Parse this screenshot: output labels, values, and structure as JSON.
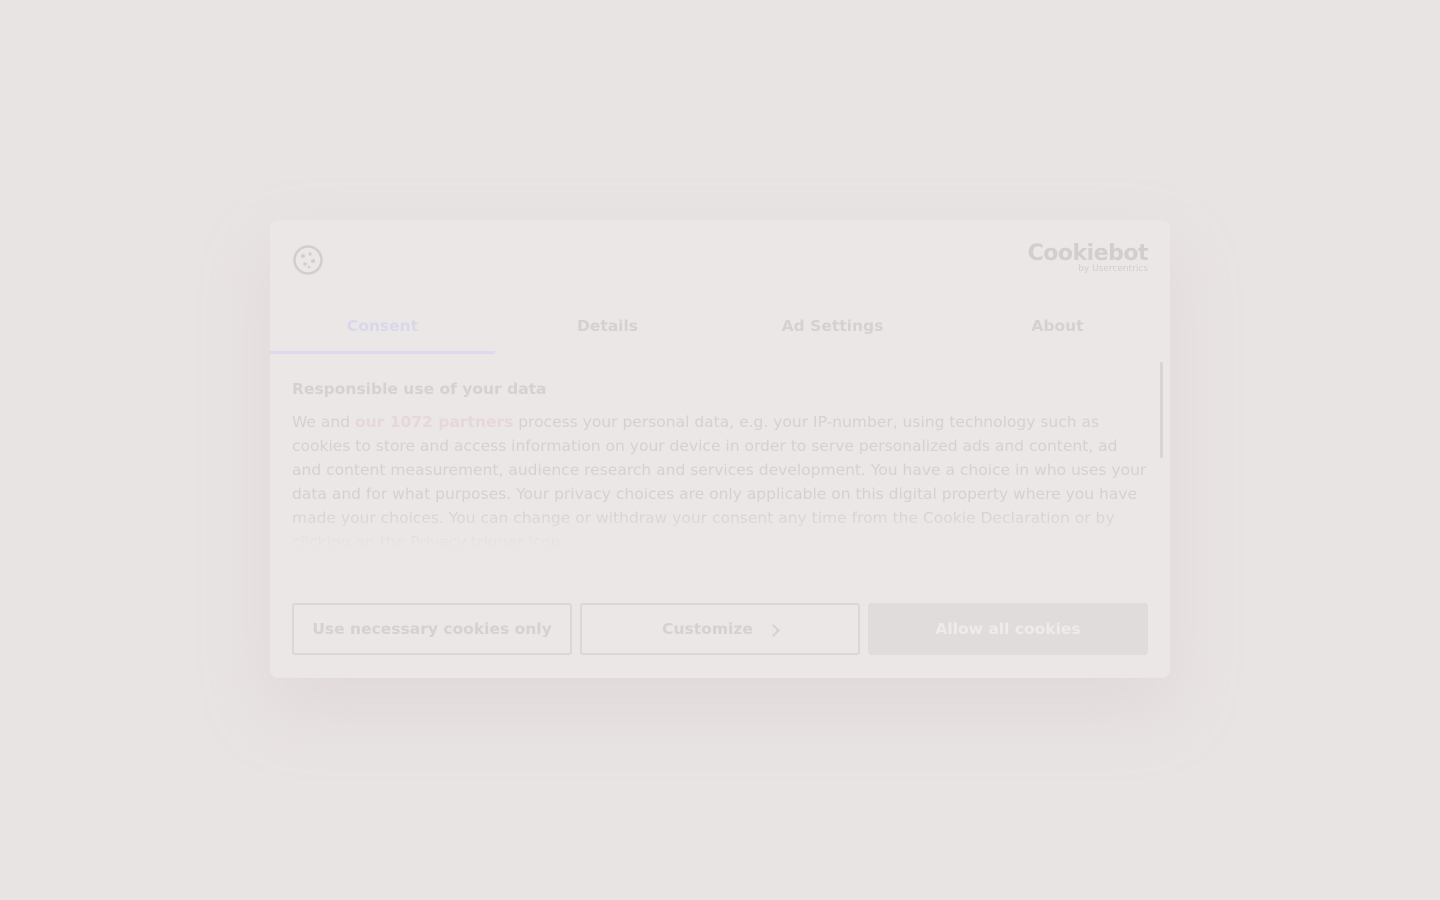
{
  "banner": {
    "brand_name": "Cookiebot",
    "brand_sub": "by Usercentrics",
    "tabs": [
      {
        "label": "Consent",
        "active": true
      },
      {
        "label": "Details",
        "active": false
      },
      {
        "label": "Ad Settings",
        "active": false
      },
      {
        "label": "About",
        "active": false
      }
    ],
    "content": {
      "title": "Responsible use of your data",
      "body_prefix": "We and ",
      "partners_link": "our 1072 partners",
      "body_suffix": " process your personal data, e.g. your IP-number, using technology such as cookies to store and access information on your device in order to serve personalized ads and content, ad and content measurement, audience research and services development. You have a choice in who uses your data and for what purposes. Your privacy choices are only applicable on this digital property where you have made your choices. You can change or withdraw your consent any time from the Cookie Declaration or by clicking on the Privacy trigger icon."
    },
    "buttons": {
      "necessary": "Use necessary cookies only",
      "customize": "Customize",
      "allow_all": "Allow all cookies"
    },
    "icons": {
      "logo": "cookie-icon",
      "customize": "chevron-right-icon"
    },
    "colors": {
      "accent": "#ddd9ee",
      "primary_button": "#e0dcdc"
    }
  }
}
